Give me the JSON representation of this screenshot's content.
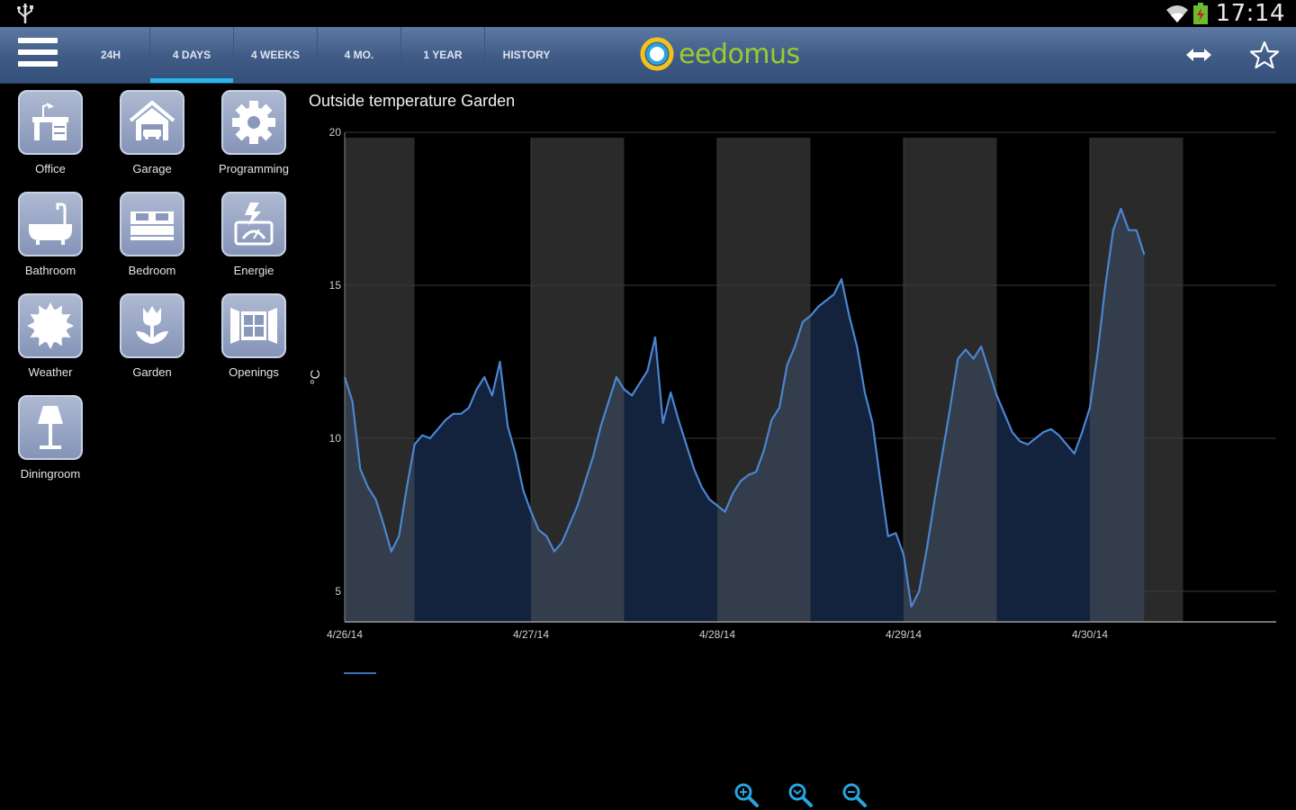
{
  "status_bar": {
    "time": "17:14",
    "icons": [
      "usb-icon",
      "wifi-icon",
      "battery-icon"
    ]
  },
  "action_bar": {
    "tabs": [
      {
        "label": "24H",
        "active": false
      },
      {
        "label": "4 DAYS",
        "active": true
      },
      {
        "label": "4 WEEKS",
        "active": false
      },
      {
        "label": "4 MO.",
        "active": false
      },
      {
        "label": "1 YEAR",
        "active": false
      },
      {
        "label": "HISTORY",
        "active": false
      }
    ],
    "logo_text": "eedomus",
    "icons": [
      "menu-icon",
      "expand-icon",
      "star-icon"
    ]
  },
  "rooms": [
    {
      "label": "Office",
      "icon": "desk-icon"
    },
    {
      "label": "Garage",
      "icon": "garage-icon"
    },
    {
      "label": "Programming",
      "icon": "gear-icon"
    },
    {
      "label": "Bathroom",
      "icon": "bathtub-icon"
    },
    {
      "label": "Bedroom",
      "icon": "bed-icon"
    },
    {
      "label": "Energie",
      "icon": "energy-meter-icon"
    },
    {
      "label": "Weather",
      "icon": "sun-icon"
    },
    {
      "label": "Garden",
      "icon": "tulip-icon"
    },
    {
      "label": "Openings",
      "icon": "window-icon"
    },
    {
      "label": "Diningroom",
      "icon": "lamp-icon"
    }
  ],
  "colors": {
    "accent": "#29b6e8",
    "actionbar": "#3f5b85",
    "series_line": "#4a86d0",
    "night_fill": "#13223d",
    "day_fill": "#333d4c"
  },
  "chart_data": {
    "type": "area",
    "title": "Outside temperature Garden",
    "xlabel": "",
    "ylabel": "°C",
    "ylim": [
      4,
      20
    ],
    "yticks": [
      5,
      10,
      15,
      20
    ],
    "xticks": [
      "4/26/14",
      "4/27/14",
      "4/28/14",
      "4/29/14",
      "4/30/14"
    ],
    "grid": true,
    "series": [
      {
        "values": [
          [
            "4/26/14 00:00",
            12.0
          ],
          [
            "4/26/14 01:00",
            11.2
          ],
          [
            "4/26/14 02:00",
            9.0
          ],
          [
            "4/26/14 03:00",
            8.4
          ],
          [
            "4/26/14 04:00",
            8.0
          ],
          [
            "4/26/14 05:00",
            7.2
          ],
          [
            "4/26/14 06:00",
            6.3
          ],
          [
            "4/26/14 07:00",
            6.8
          ],
          [
            "4/26/14 08:00",
            8.4
          ],
          [
            "4/26/14 09:00",
            9.8
          ],
          [
            "4/26/14 10:00",
            10.1
          ],
          [
            "4/26/14 11:00",
            10.0
          ],
          [
            "4/26/14 12:00",
            10.3
          ],
          [
            "4/26/14 13:00",
            10.6
          ],
          [
            "4/26/14 14:00",
            10.8
          ],
          [
            "4/26/14 15:00",
            10.8
          ],
          [
            "4/26/14 16:00",
            11.0
          ],
          [
            "4/26/14 17:00",
            11.6
          ],
          [
            "4/26/14 18:00",
            12.0
          ],
          [
            "4/26/14 19:00",
            11.4
          ],
          [
            "4/26/14 20:00",
            12.5
          ],
          [
            "4/26/14 21:00",
            10.4
          ],
          [
            "4/26/14 22:00",
            9.5
          ],
          [
            "4/26/14 23:00",
            8.3
          ],
          [
            "4/27/14 00:00",
            7.6
          ],
          [
            "4/27/14 01:00",
            7.0
          ],
          [
            "4/27/14 02:00",
            6.8
          ],
          [
            "4/27/14 03:00",
            6.3
          ],
          [
            "4/27/14 04:00",
            6.6
          ],
          [
            "4/27/14 05:00",
            7.2
          ],
          [
            "4/27/14 06:00",
            7.8
          ],
          [
            "4/27/14 07:00",
            8.6
          ],
          [
            "4/27/14 08:00",
            9.4
          ],
          [
            "4/27/14 09:00",
            10.4
          ],
          [
            "4/27/14 10:00",
            11.2
          ],
          [
            "4/27/14 11:00",
            12.0
          ],
          [
            "4/27/14 12:00",
            11.6
          ],
          [
            "4/27/14 13:00",
            11.4
          ],
          [
            "4/27/14 14:00",
            11.8
          ],
          [
            "4/27/14 15:00",
            12.2
          ],
          [
            "4/27/14 16:00",
            13.3
          ],
          [
            "4/27/14 17:00",
            10.5
          ],
          [
            "4/27/14 18:00",
            11.5
          ],
          [
            "4/27/14 19:00",
            10.6
          ],
          [
            "4/27/14 20:00",
            9.8
          ],
          [
            "4/27/14 21:00",
            9.0
          ],
          [
            "4/27/14 22:00",
            8.4
          ],
          [
            "4/27/14 23:00",
            8.0
          ],
          [
            "4/28/14 00:00",
            7.8
          ],
          [
            "4/28/14 01:00",
            7.6
          ],
          [
            "4/28/14 02:00",
            8.2
          ],
          [
            "4/28/14 03:00",
            8.6
          ],
          [
            "4/28/14 04:00",
            8.8
          ],
          [
            "4/28/14 05:00",
            8.9
          ],
          [
            "4/28/14 06:00",
            9.6
          ],
          [
            "4/28/14 07:00",
            10.6
          ],
          [
            "4/28/14 08:00",
            11.0
          ],
          [
            "4/28/14 09:00",
            12.4
          ],
          [
            "4/28/14 10:00",
            13.0
          ],
          [
            "4/28/14 11:00",
            13.8
          ],
          [
            "4/28/14 12:00",
            14.0
          ],
          [
            "4/28/14 13:00",
            14.3
          ],
          [
            "4/28/14 14:00",
            14.5
          ],
          [
            "4/28/14 15:00",
            14.7
          ],
          [
            "4/28/14 16:00",
            15.2
          ],
          [
            "4/28/14 17:00",
            14.0
          ],
          [
            "4/28/14 18:00",
            13.0
          ],
          [
            "4/28/14 19:00",
            11.5
          ],
          [
            "4/28/14 20:00",
            10.5
          ],
          [
            "4/28/14 21:00",
            8.6
          ],
          [
            "4/28/14 22:00",
            6.8
          ],
          [
            "4/28/14 23:00",
            6.9
          ],
          [
            "4/29/14 00:00",
            6.2
          ],
          [
            "4/29/14 01:00",
            4.5
          ],
          [
            "4/29/14 02:00",
            5.0
          ],
          [
            "4/29/14 03:00",
            6.4
          ],
          [
            "4/29/14 04:00",
            8.0
          ],
          [
            "4/29/14 05:00",
            9.5
          ],
          [
            "4/29/14 06:00",
            11.0
          ],
          [
            "4/29/14 07:00",
            12.6
          ],
          [
            "4/29/14 08:00",
            12.9
          ],
          [
            "4/29/14 09:00",
            12.6
          ],
          [
            "4/29/14 10:00",
            13.0
          ],
          [
            "4/29/14 11:00",
            12.2
          ],
          [
            "4/29/14 12:00",
            11.4
          ],
          [
            "4/29/14 13:00",
            10.8
          ],
          [
            "4/29/14 14:00",
            10.2
          ],
          [
            "4/29/14 15:00",
            9.9
          ],
          [
            "4/29/14 16:00",
            9.8
          ],
          [
            "4/29/14 17:00",
            10.0
          ],
          [
            "4/29/14 18:00",
            10.2
          ],
          [
            "4/29/14 19:00",
            10.3
          ],
          [
            "4/29/14 20:00",
            10.1
          ],
          [
            "4/29/14 21:00",
            9.8
          ],
          [
            "4/29/14 22:00",
            9.5
          ],
          [
            "4/29/14 23:00",
            10.2
          ],
          [
            "4/30/14 00:00",
            11.0
          ],
          [
            "4/30/14 01:00",
            12.8
          ],
          [
            "4/30/14 02:00",
            15.0
          ],
          [
            "4/30/14 03:00",
            16.8
          ],
          [
            "4/30/14 04:00",
            17.5
          ],
          [
            "4/30/14 05:00",
            16.8
          ],
          [
            "4/30/14 06:00",
            16.8
          ],
          [
            "4/30/14 07:00",
            16.0
          ]
        ]
      }
    ],
    "shading": {
      "day_bands": [
        [
          "4/26/14 00:00",
          "4/26/14 09:00"
        ],
        [
          "4/27/14 00:00",
          "4/27/14 12:00"
        ],
        [
          "4/28/14 00:00",
          "4/28/14 12:00"
        ],
        [
          "4/29/14 00:00",
          "4/29/14 12:00"
        ],
        [
          "4/30/14 00:00",
          "4/30/14 12:00"
        ]
      ]
    }
  },
  "zoom_controls": [
    "zoom-in-icon",
    "zoom-reset-icon",
    "zoom-out-icon"
  ]
}
